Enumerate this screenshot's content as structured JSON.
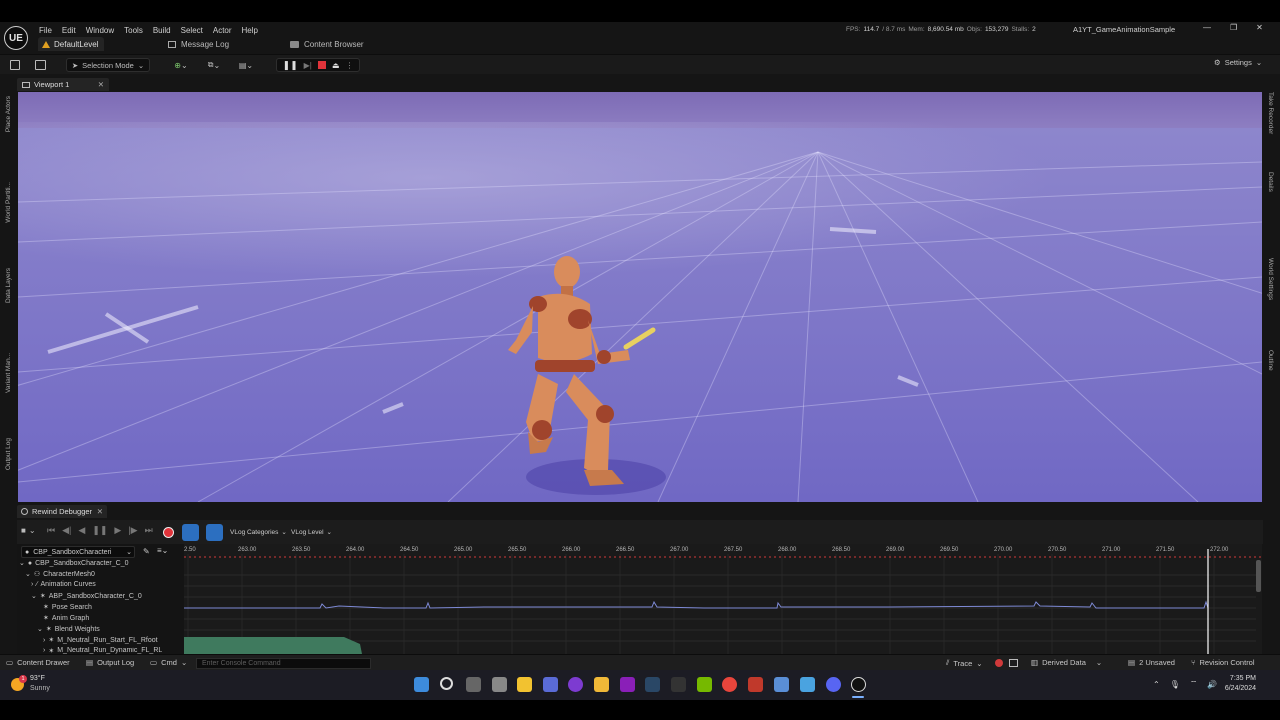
{
  "app": {
    "logo": "UE",
    "menu": [
      "File",
      "Edit",
      "Window",
      "Tools",
      "Build",
      "Select",
      "Actor",
      "Help"
    ],
    "level_tab": "DefaultLevel",
    "tabs": [
      "Message Log",
      "Content Browser"
    ],
    "project_name": "A1YT_GameAnimationSample",
    "stats": {
      "fps_label": "FPS:",
      "fps": "114.7",
      "ms": "/ 8.7 ms",
      "mem_label": "Mem:",
      "mem": "8,690.54 mb",
      "objs_label": "Objs:",
      "objs": "153,279",
      "stalls_label": "Stalls:",
      "stalls": "2"
    }
  },
  "toolbar": {
    "selection_mode": "Selection Mode",
    "settings": "Settings"
  },
  "left_sidebar": [
    "Place Actors",
    "World Partiti...",
    "Data Layers",
    "Variant Man...",
    "Output Log"
  ],
  "right_sidebar": [
    "Take Recorder",
    "Details",
    "World Settings",
    "Outline"
  ],
  "viewport": {
    "tab": "Viewport 1",
    "colors": {
      "sky": "#8a78be",
      "ground": "#7b74c8",
      "grid": "#e8e6ff",
      "character": "#d88a5a"
    }
  },
  "rewind": {
    "tab": "Rewind Debugger",
    "vlog_categories": "VLog Categories",
    "vlog_level": "VLog Level",
    "actor_select": "CBP_SandboxCharacteri",
    "tree": [
      "CBP_SandboxCharacter_C_0",
      "CharacterMesh0",
      "Animation Curves",
      "ABP_SandboxCharacter_C_0",
      "Pose Search",
      "Anim Graph",
      "Blend Weights",
      "M_Neutral_Run_Start_FL_Rfoot",
      "M_Neutral_Run_Dynamic_FL_RL"
    ],
    "ticks": [
      "2.50",
      "263.00",
      "263.50",
      "264.00",
      "264.50",
      "265.00",
      "265.50",
      "266.00",
      "266.50",
      "267.00",
      "267.50",
      "268.00",
      "268.50",
      "269.00",
      "269.50",
      "270.00",
      "270.50",
      "271.00",
      "271.50",
      "272.00"
    ]
  },
  "statusbar": {
    "content_drawer": "Content Drawer",
    "output_log": "Output Log",
    "cmd": "Cmd",
    "console_placeholder": "Enter Console Command",
    "trace": "Trace",
    "derived_data": "Derived Data",
    "unsaved": "2 Unsaved",
    "revision": "Revision Control"
  },
  "taskbar": {
    "temp": "93°F",
    "weather": "Sunny",
    "weather_badge": "1",
    "time": "7:35 PM",
    "date": "6/24/2024",
    "icons": [
      "windows-icon",
      "search-icon",
      "task-view-icon",
      "sticky-notes-icon",
      "snipping-icon",
      "obs-icon",
      "file-explorer-icon",
      "next-icon",
      "steam-icon",
      "epic-icon",
      "nvidia-icon",
      "chrome-icon",
      "app-icon",
      "calculator-icon",
      "notepad-icon",
      "discord-icon",
      "unreal-icon"
    ]
  }
}
